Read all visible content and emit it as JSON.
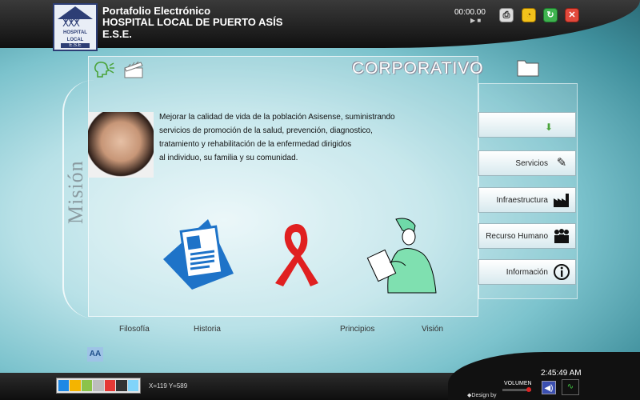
{
  "header": {
    "line1": "Portafolio Electrónico",
    "line2": "HOSPITAL LOCAL DE PUERTO ASÍS",
    "line3": "E.S.E.",
    "timer": "00:00.00",
    "logo_text_1": "HOSPITAL",
    "logo_text_2": "LOCAL",
    "logo_text_3": "E.S.E"
  },
  "section_title": "CORPORATIVO",
  "vertical_title": "Misión",
  "mission": {
    "lines": [
      "Mejorar la calidad de vida de la población Asisense, suministrando",
      "servicios de promoción de la salud, prevención, diagnostico,",
      "tratamiento y rehabilitación de la enfermedad dirigidos",
      "al individuo, su familia y su comunidad."
    ]
  },
  "tabs": [
    "Filosofía",
    "Historia",
    "Principios",
    "Visión"
  ],
  "menu": {
    "servicios": "Servicios",
    "infraestructura": "Infraestructura",
    "recurso": "Recurso  Humano",
    "informacion": "Información"
  },
  "font_button": "AA",
  "footer": {
    "coords": "X=119   Y=589",
    "clock": "2:45:49 AM",
    "volumen": "VOLUMEN",
    "design": "Design by"
  },
  "palette": [
    "#1e88e5",
    "#f4b400",
    "#8bc34a",
    "#bdbdbd",
    "#e53935",
    "#333333",
    "#81d4fa"
  ],
  "icons": {
    "print": "printer-icon",
    "clock": "clock-icon",
    "refresh": "refresh-icon",
    "close": "close-icon"
  }
}
